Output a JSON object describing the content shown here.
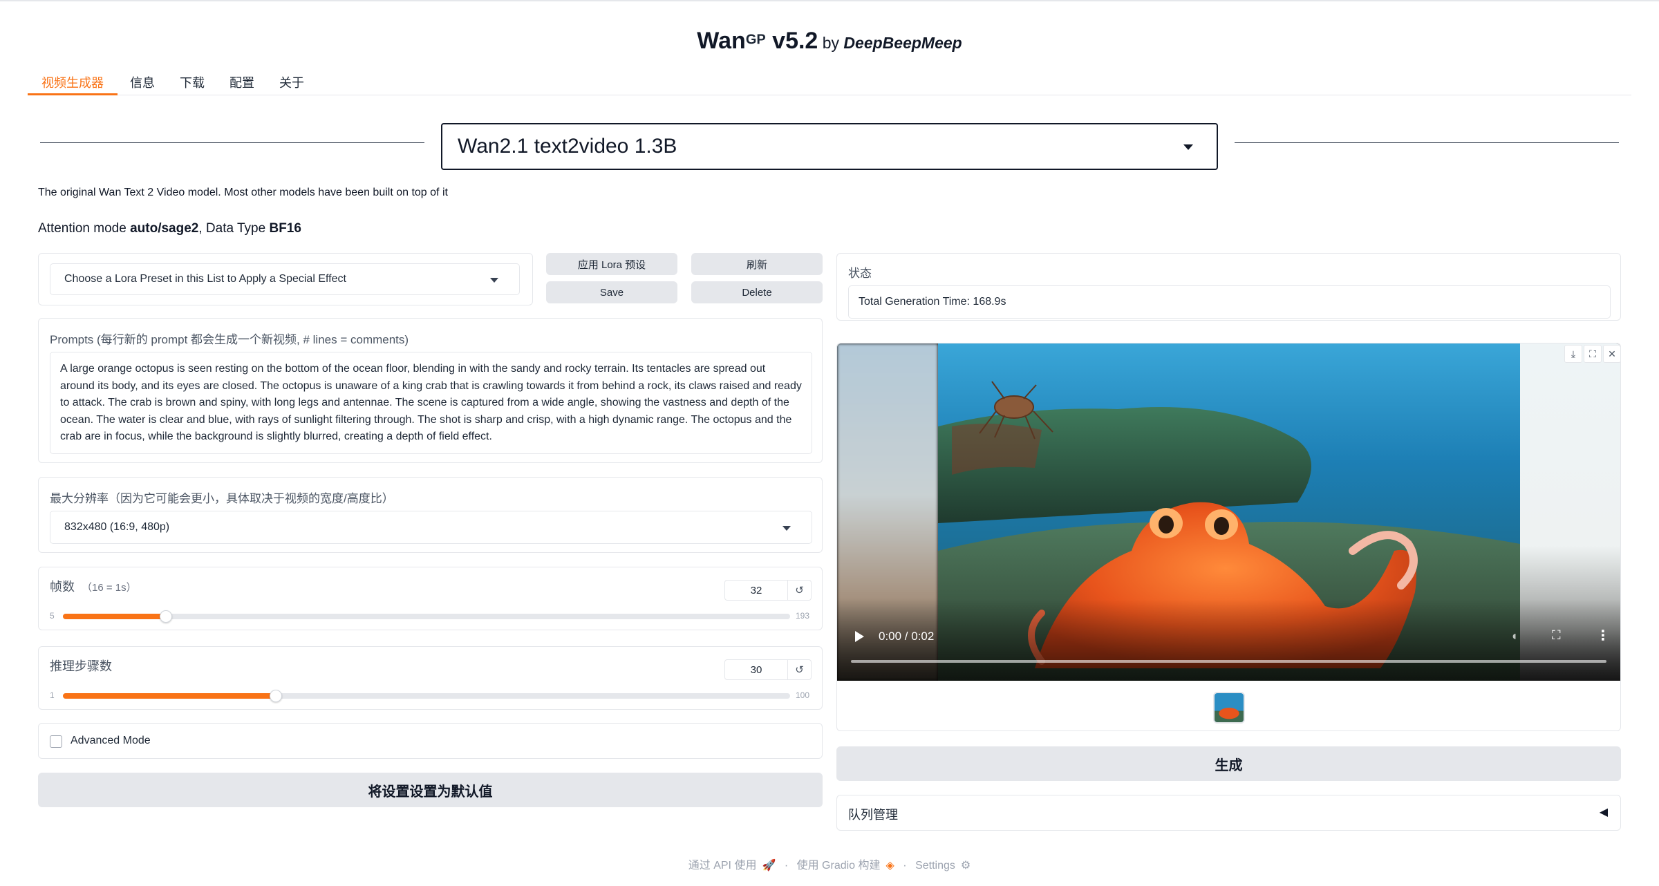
{
  "header": {
    "title_main": "Wan",
    "title_sup": "GP",
    "title_version": " v5.2",
    "title_by": " by ",
    "title_author": "DeepBeepMeep"
  },
  "tabs": [
    {
      "label": "视频生成器",
      "active": true
    },
    {
      "label": "信息"
    },
    {
      "label": "下载"
    },
    {
      "label": "配置"
    },
    {
      "label": "关于"
    }
  ],
  "model": {
    "selected": "Wan2.1 text2video 1.3B",
    "description": "The original Wan Text 2 Video model. Most other models have been built on top of it"
  },
  "attention": {
    "prefix": "Attention mode ",
    "mode": "auto/sage2",
    "mid": ", Data Type ",
    "dtype": "BF16"
  },
  "lora": {
    "placeholder": "Choose a Lora Preset in this List to Apply a Special Effect",
    "apply_label": "应用 Lora 预设",
    "refresh_label": "刷新",
    "save_label": "Save",
    "delete_label": "Delete"
  },
  "prompt": {
    "label": "Prompts (每行新的 prompt 都会生成一个新视频, # lines = comments)",
    "value": "A large orange octopus is seen resting on the bottom of the ocean floor, blending in with the sandy and rocky terrain. Its tentacles are spread out around its body, and its eyes are closed. The octopus is unaware of a king crab that is crawling towards it from behind a rock, its claws raised and ready to attack. The crab is brown and spiny, with long legs and antennae. The scene is captured from a wide angle, showing the vastness and depth of the ocean. The water is clear and blue, with rays of sunlight filtering through. The shot is sharp and crisp, with a high dynamic range. The octopus and the crab are in focus, while the background is slightly blurred, creating a depth of field effect."
  },
  "resolution": {
    "label": "最大分辨率（因为它可能会更小，具体取决于视频的宽度/高度比）",
    "selected": "832x480 (16:9, 480p)"
  },
  "frames": {
    "label": "帧数",
    "hint": "（16 = 1s）",
    "value": "32",
    "min": "5",
    "max": "193",
    "fraction": 0.142
  },
  "steps": {
    "label": "推理步骤数",
    "value": "30",
    "min": "1",
    "max": "100",
    "fraction": 0.293
  },
  "advanced": {
    "label": "Advanced Mode",
    "checked": false
  },
  "set_default_label": "将设置设置为默认值",
  "status": {
    "label": "状态",
    "value": "Total Generation Time: 168.9s"
  },
  "video": {
    "time": "0:00 / 0:02"
  },
  "generate_label": "生成",
  "queue": {
    "label": "队列管理",
    "arrow": "◀"
  },
  "footer": {
    "api": "通过 API 使用",
    "gradio": "使用 Gradio 构建",
    "settings": "Settings",
    "sep": "·"
  },
  "colors": {
    "accent": "#f97316",
    "button_bg": "#e5e7eb"
  }
}
